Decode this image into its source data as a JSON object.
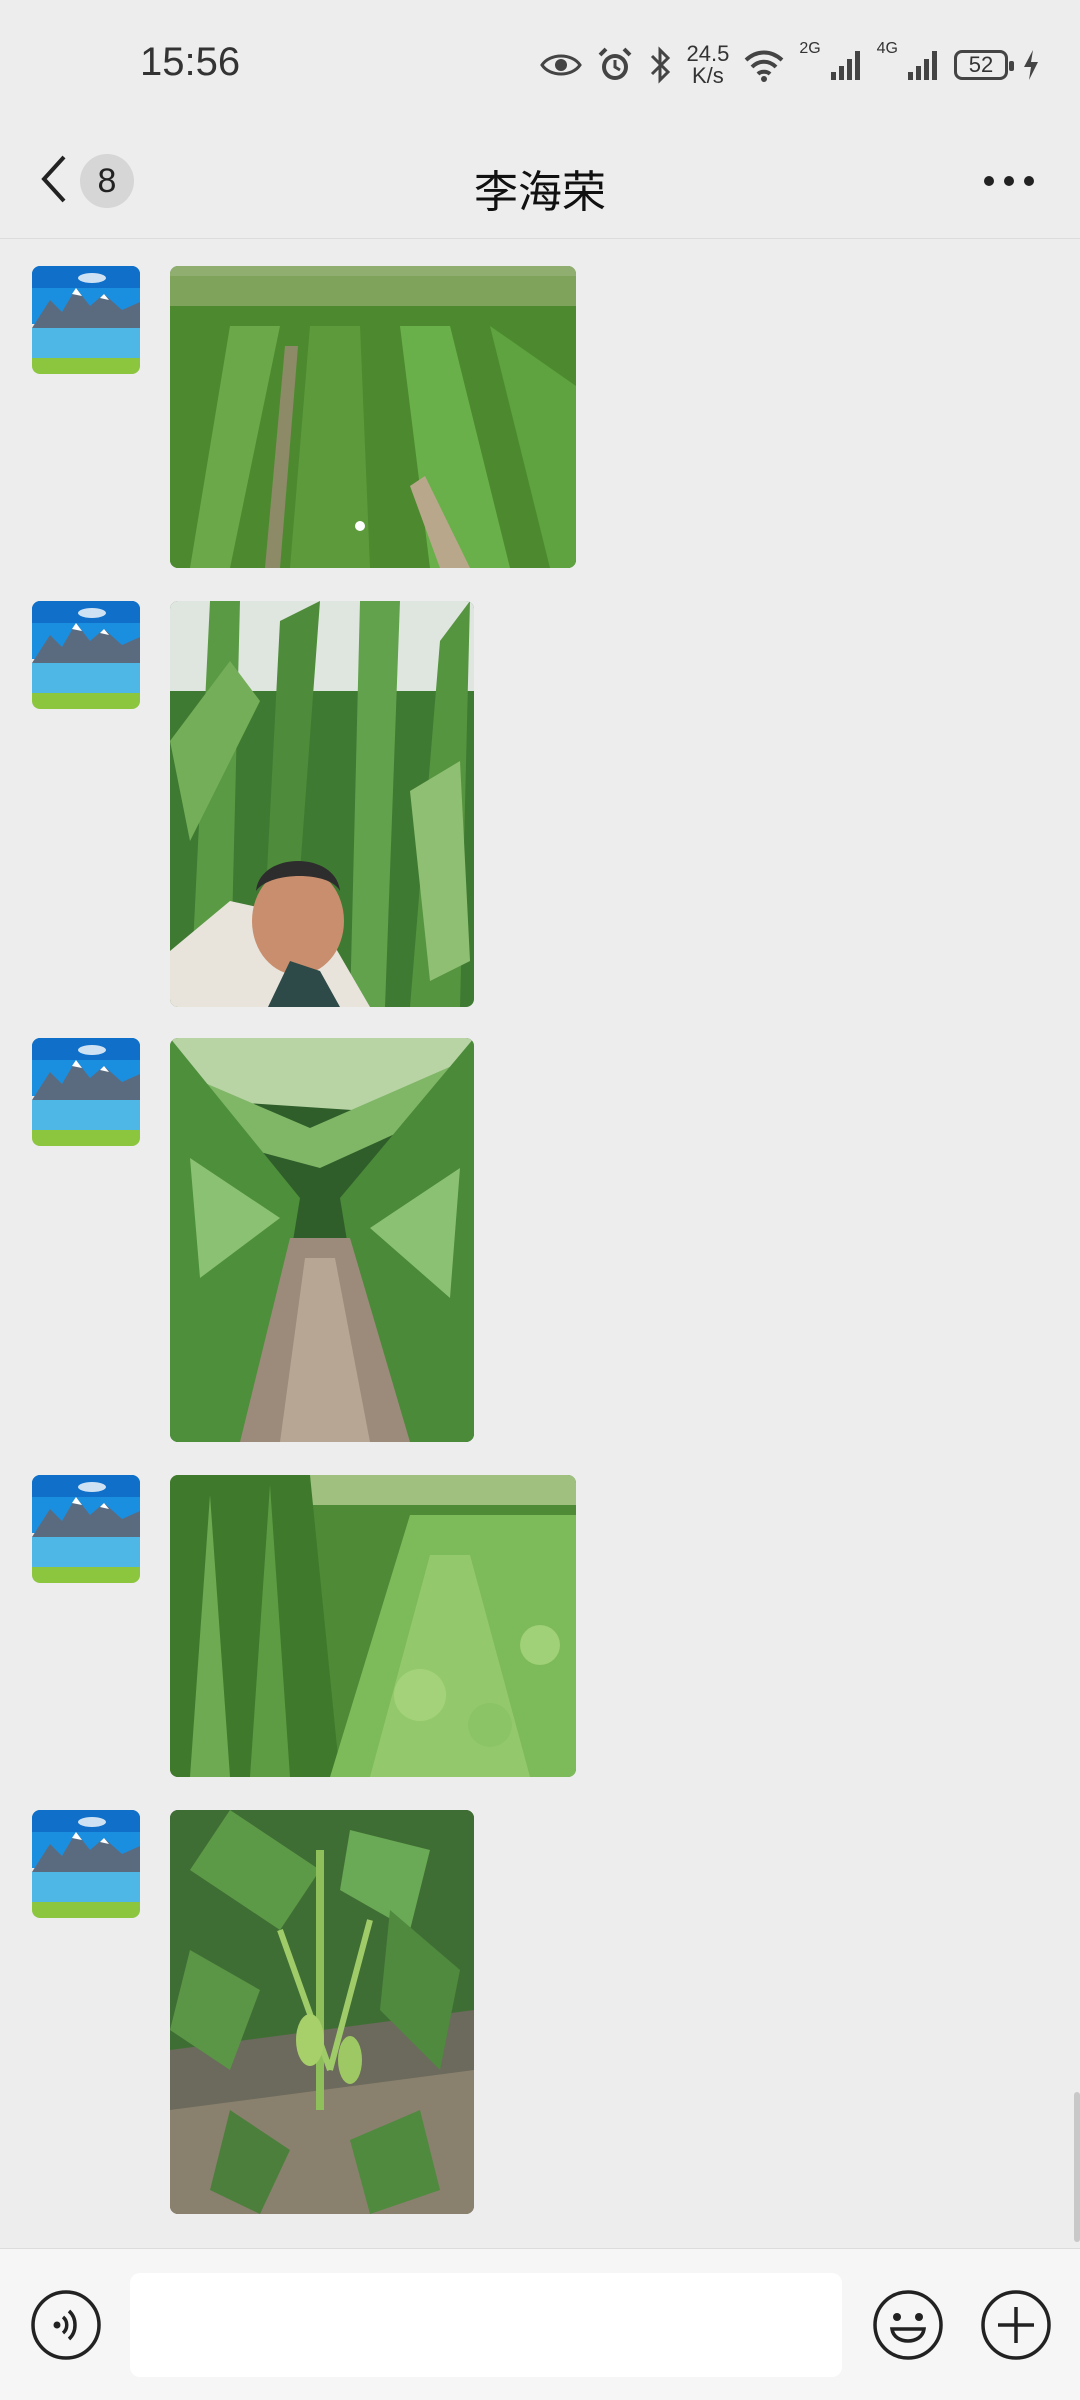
{
  "status_bar": {
    "time": "15:56",
    "net_speed_value": "24.5",
    "net_speed_unit": "K/s",
    "sim1_label": "2G",
    "sim2_label": "4G",
    "battery_level": "52"
  },
  "header": {
    "unread_count": "8",
    "title": "李海荣"
  },
  "messages": [
    {
      "type": "image",
      "orientation": "landscape",
      "subject": "bean field rows"
    },
    {
      "type": "image",
      "orientation": "portrait",
      "subject": "selfie in corn field"
    },
    {
      "type": "image",
      "orientation": "portrait",
      "subject": "corn row path"
    },
    {
      "type": "image",
      "orientation": "landscape",
      "subject": "corn and bean intercrop"
    },
    {
      "type": "image",
      "orientation": "portrait",
      "subject": "soybean plant close-up"
    }
  ],
  "input_bar": {
    "placeholder": "",
    "icons": [
      "voice-icon",
      "emoji-icon",
      "plus-icon"
    ]
  },
  "colors": {
    "background": "#ededed",
    "header_text": "#111111",
    "input_bar_bg": "#f6f6f6"
  }
}
